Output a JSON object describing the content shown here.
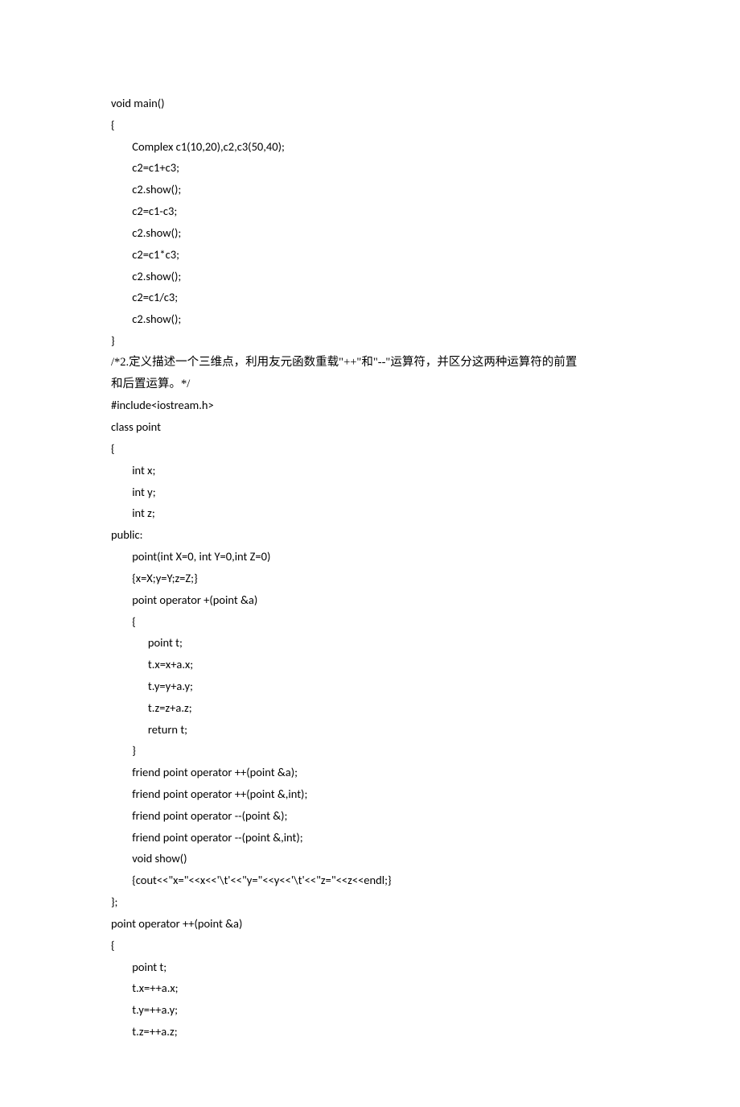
{
  "lines": [
    "void main()",
    "{",
    "        Complex c1(10,20),c2,c3(50,40);",
    "        c2=c1+c3;",
    "        c2.show();",
    "        c2=c1-c3;",
    "        c2.show();",
    "        c2=c1*c3;",
    "        c2.show();",
    "        c2=c1/c3;",
    "        c2.show();",
    "}",
    "/*2.定义描述一个三维点，利用友元函数重载\"++\"和\"--\"运算符，并区分这两种运算符的前置",
    "和后置运算。*/",
    "#include<iostream.h>",
    "class point",
    "{",
    "        int x;",
    "        int y;",
    "        int z;",
    "public:",
    "        point(int X=0, int Y=0,int Z=0)",
    "        {x=X;y=Y;z=Z;}",
    "        point operator +(point &a)",
    "        {",
    "              point t;",
    "              t.x=x+a.x;",
    "              t.y=y+a.y;",
    "              t.z=z+a.z;",
    "              return t;",
    "        }",
    "        friend point operator ++(point &a);",
    "        friend point operator ++(point &,int);",
    "        friend point operator --(point &);",
    "        friend point operator --(point &,int);",
    "        void show()",
    "        {cout<<\"x=\"<<x<<'\\t'<<\"y=\"<<y<<'\\t'<<\"z=\"<<z<<endl;}",
    "};",
    "point operator ++(point &a)",
    "{",
    "        point t;",
    "        t.x=++a.x;",
    "        t.y=++a.y;",
    "        t.z=++a.z;"
  ]
}
